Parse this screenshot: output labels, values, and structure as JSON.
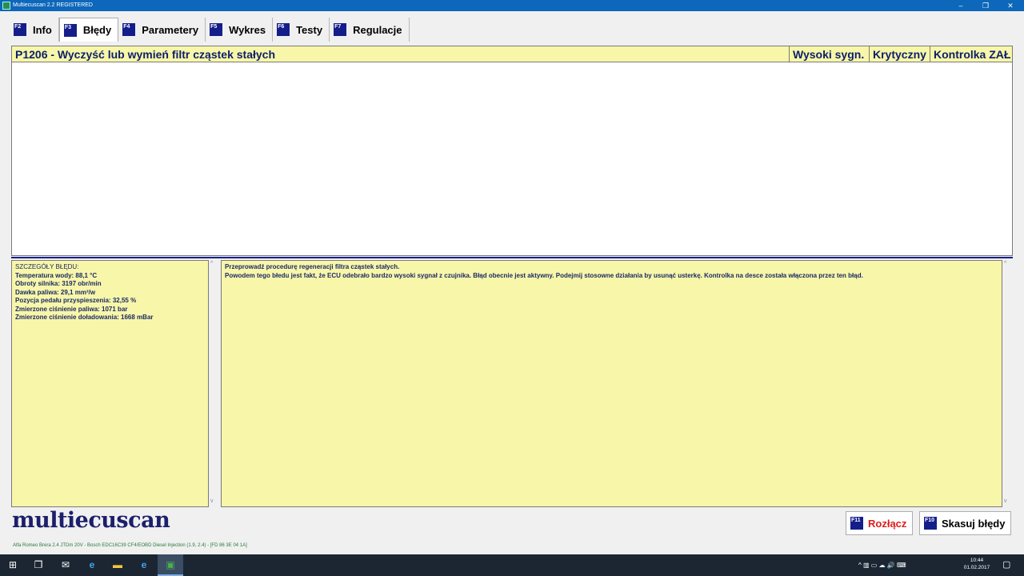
{
  "window": {
    "title": "Multiecuscan 2.2 REGISTERED",
    "controls": {
      "minimize": "–",
      "maximize": "❐",
      "close": "✕"
    }
  },
  "tabs": [
    {
      "key": "F2",
      "label": "Info"
    },
    {
      "key": "F3",
      "label": "Błędy",
      "active": true
    },
    {
      "key": "F4",
      "label": "Parametery"
    },
    {
      "key": "F5",
      "label": "Wykres"
    },
    {
      "key": "F6",
      "label": "Testy"
    },
    {
      "key": "F7",
      "label": "Regulacje"
    }
  ],
  "error_table": {
    "code_description": "P1206 - Wyczyść lub wymień filtr cząstek stałych",
    "columns": [
      "Wysoki sygn.",
      "Krytyczny",
      "Kontrolka ZAŁ"
    ]
  },
  "details": {
    "heading": "SZCZEGÓŁY BŁĘDU:",
    "lines": [
      "Temperatura wody: 88,1 °C",
      "Obroty silnika: 3197 obr/min",
      "Dawka paliwa: 29,1 mm³/w",
      "Pozycja pedału przyspieszenia: 32,55 %",
      "Zmierzone ciśnienie paliwa: 1071 bar",
      "Zmierzone ciśnienie doładowania: 1668 mBar"
    ]
  },
  "description": {
    "lines": [
      "Przeprowadź procedurę regeneracji filtra cząstek stałych.",
      "Powodem tego błedu jest fakt, że ECU odebrało bardzo wysoki sygnał z czujnika. Błąd obecnie jest aktywny. Podejmij stosowne działania by usunąć usterkę. Kontrolka na desce została włączona przez ten błąd."
    ]
  },
  "logo": "multiecuscan",
  "buttons": {
    "disconnect": {
      "key": "F11",
      "label": "Rozłącz",
      "color": "#e01b1b"
    },
    "clear_errors": {
      "key": "F10",
      "label": "Skasuj błędy"
    }
  },
  "status": "Alfa Romeo Brera 2.4 JTDm 20V - Bosch EDC16C39 CF4/EOBD Diesel Injection (1.9, 2.4) - [FD 86 3E 04 1A]",
  "taskbar": {
    "apps": [
      {
        "name": "start",
        "icon": "⊞"
      },
      {
        "name": "task-view",
        "icon": "❐"
      },
      {
        "name": "mail",
        "icon": "✉"
      },
      {
        "name": "internet-explorer",
        "icon": "e"
      },
      {
        "name": "file-explorer",
        "icon": "▬"
      },
      {
        "name": "edge",
        "icon": "e"
      },
      {
        "name": "multiecuscan",
        "icon": "▣"
      }
    ],
    "tray_icons": "^  ▥  ▭  ☁  🔊  ⌨",
    "time": "10:44",
    "date": "01.02.2017",
    "notification_icon": "▢"
  }
}
